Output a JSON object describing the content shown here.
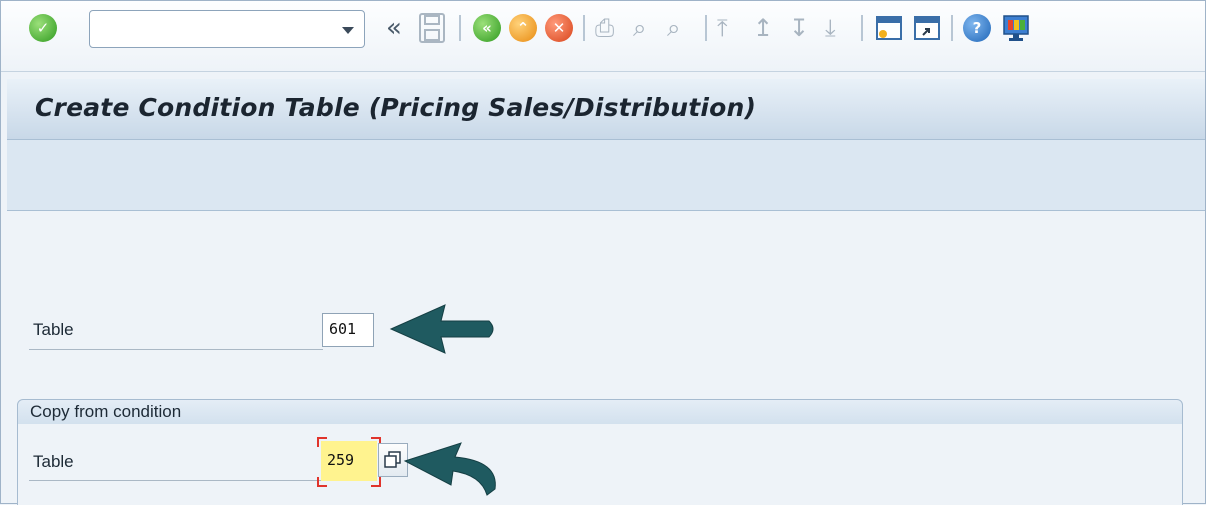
{
  "toolbar": {
    "command_field": {
      "value": "",
      "placeholder": ""
    },
    "icons": [
      "enter-check-icon",
      "command-dropdown-icon",
      "collapse-icon",
      "save-icon",
      "back-icon",
      "exit-icon",
      "cancel-icon",
      "print-icon",
      "find-icon",
      "find-next-icon",
      "first-page-icon",
      "previous-page-icon",
      "next-page-icon",
      "last-page-icon",
      "create-session-icon",
      "shortcut-icon",
      "help-icon",
      "customize-layout-icon"
    ]
  },
  "header": {
    "title": "Create Condition Table (Pricing Sales/Distribution)"
  },
  "form": {
    "table_label": "Table",
    "table_value": "601",
    "copy_group_title": "Copy from condition",
    "copy_table_label": "Table",
    "copy_table_value": "259"
  },
  "colors": {
    "accent": "#2f9a1f",
    "highlight": "#fff38f",
    "arrow": "#1f5a60",
    "focus": "#e0342c"
  }
}
